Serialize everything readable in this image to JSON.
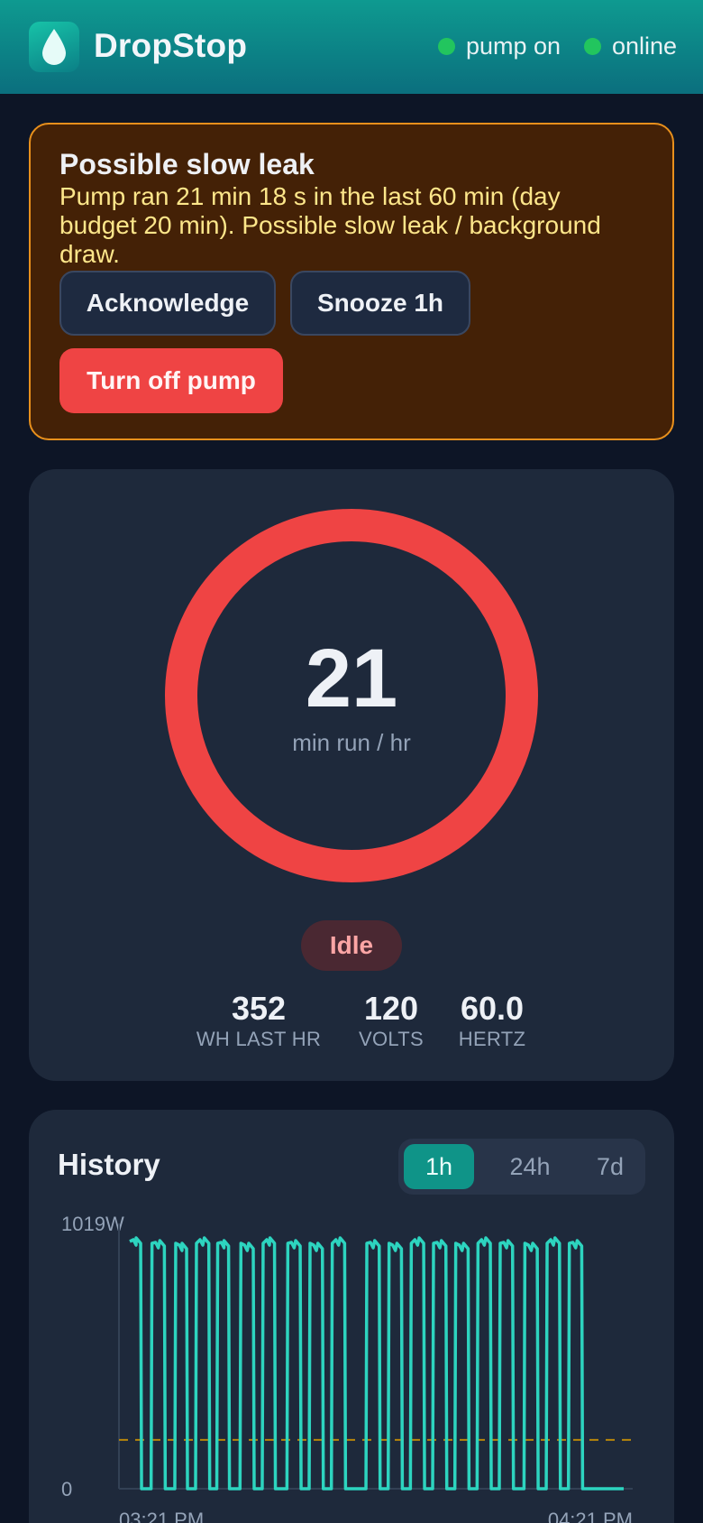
{
  "app": {
    "name": "DropStop",
    "icon": "water-drop-icon"
  },
  "status": {
    "pump": "pump on",
    "connection": "online",
    "dot_color": "#22c55e"
  },
  "alert": {
    "title": "Possible slow leak",
    "message": "Pump ran 21 min 18 s in the last 60 min (day budget 20 min). Possible slow leak / background draw.",
    "acknowledge_label": "Acknowledge",
    "snooze_label": "Snooze 1h",
    "turn_off_label": "Turn off pump",
    "border_color": "#e8901c",
    "danger_color": "#ef4444"
  },
  "gauge": {
    "value": "21",
    "unit": "min run / hr",
    "ring_color": "#ef4444",
    "state": "Idle",
    "metrics": [
      {
        "value": "352",
        "label": "WH LAST HR"
      },
      {
        "value": "120",
        "label": "VOLTS"
      },
      {
        "value": "60.0",
        "label": "HERTZ"
      }
    ]
  },
  "history": {
    "title": "History",
    "ranges": [
      "1h",
      "24h",
      "7d"
    ],
    "active_range": "1h",
    "chart_data": {
      "type": "line",
      "ymax_label": "1019W",
      "ymin_label": "0",
      "x_labels": [
        "03:21 PM",
        "04:21 PM"
      ],
      "ylim": [
        0,
        1019
      ],
      "threshold": 200,
      "line_color": "#2dd4bf",
      "threshold_color": "#b8860b",
      "cycles": [
        [
          0.0,
          0.022
        ],
        [
          0.045,
          0.07
        ],
        [
          0.093,
          0.115
        ],
        [
          0.135,
          0.16
        ],
        [
          0.178,
          0.2
        ],
        [
          0.225,
          0.25
        ],
        [
          0.27,
          0.293
        ],
        [
          0.32,
          0.345
        ],
        [
          0.365,
          0.39
        ],
        [
          0.41,
          0.435
        ],
        [
          0.48,
          0.505
        ],
        [
          0.525,
          0.55
        ],
        [
          0.57,
          0.595
        ],
        [
          0.615,
          0.64
        ],
        [
          0.66,
          0.685
        ],
        [
          0.705,
          0.73
        ],
        [
          0.75,
          0.775
        ],
        [
          0.8,
          0.825
        ],
        [
          0.845,
          0.87
        ],
        [
          0.89,
          0.915
        ]
      ]
    }
  }
}
